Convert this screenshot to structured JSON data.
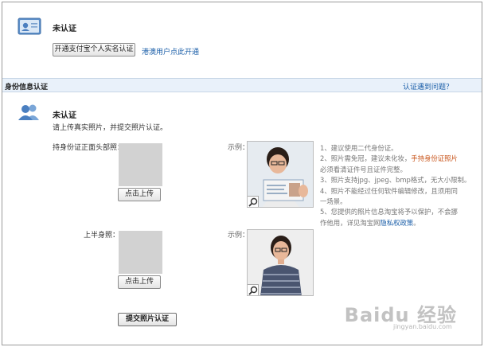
{
  "top": {
    "status": "未认证",
    "open_button": "开通支付宝个人实名认证",
    "hk_link": "港澳用户点此开通"
  },
  "section": {
    "title": "身份信息认证",
    "help_link": "认证遇到问题？"
  },
  "main": {
    "status": "未认证",
    "instruction": "请上传真实照片，并提交照片认证。",
    "id_photo_label": "持身份证正面头部照：",
    "upload_button_1": "点击上传",
    "example_label_1": "示例：",
    "half_photo_label": "上半身照：",
    "upload_button_2": "点击上传",
    "example_label_2": "示例：",
    "submit_button": "提交照片认证"
  },
  "tips": {
    "l1": "1、建议使用二代身份证。",
    "l2a": "2、照片需免冠，建议未化妆，",
    "l2b": "手持身份证照片",
    "l3": "必须看清证件号且证件完整。",
    "l4": "3、照片支持jpg、jpeg、bmp格式，无大小限制。",
    "l5": "4、照片不能经过任何软件编辑修改，且须用同",
    "l6": "一场景。",
    "l7": "5、您提供的照片信息淘宝将予以保护，不会挪",
    "l8a": "作他用，详见淘宝网",
    "l8b": "隐私权政策",
    "l8c": "。"
  },
  "watermark": {
    "main": "Baidu 经验",
    "sub": "jingyan.baidu.com"
  },
  "colors": {
    "link": "#1a5ea8",
    "section_bar": "#e9f1fa",
    "highlight": "#c8541a"
  },
  "icons": [
    "id-card-icon",
    "users-icon",
    "magnifier-icon"
  ]
}
